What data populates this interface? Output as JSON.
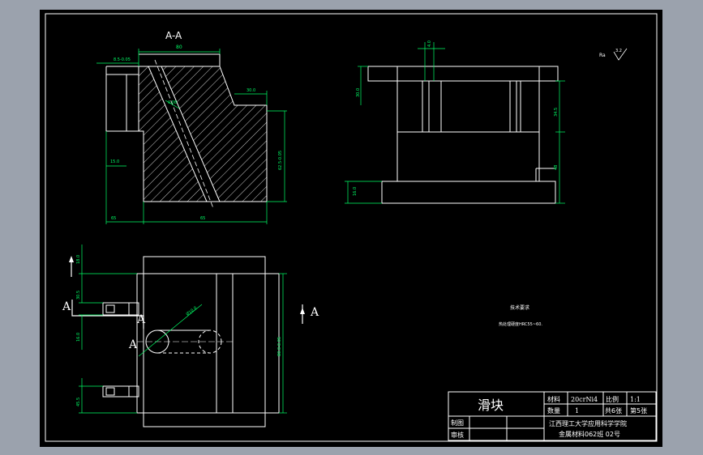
{
  "section_title": "A-A",
  "section_marks": {
    "a_left_top": "A",
    "a_left_mid": "A",
    "a_left_low": "A",
    "a_right": "A"
  },
  "dimensions": {
    "top_width": "80",
    "left_small": "8.5-0.05",
    "step_width": "30.0",
    "bottom_left": "65",
    "bottom_right": "65",
    "left_height": "15.0",
    "right_height": "62.5-0.05",
    "hole_angle": "0.08",
    "side_top": "4.0",
    "side_left_high": "30.0",
    "side_right_upper": "34.5",
    "side_right_lower": "48",
    "side_left_low": "16.0",
    "plan_left_1": "18.0",
    "plan_left_2": "30.5",
    "plan_left_3": "16.0",
    "plan_left_4": "45.5",
    "plan_diameter": "Ø10.0",
    "plan_right_height": "80.0-0.05"
  },
  "roughness": {
    "label": "Ra",
    "value": "3.2"
  },
  "tech_requirements": {
    "title": "技术要求",
    "line1": "热处理硬度HRC55~60."
  },
  "title_block": {
    "part_name": "滑块",
    "material_label": "材料",
    "material_value": "20crNi4",
    "scale_label": "比例",
    "scale_value": "1:1",
    "qty_label": "数量",
    "qty_value": "1",
    "sheets_total": "共6张",
    "sheet_no": "第5张",
    "drawn_label": "制图",
    "checked_label": "审核",
    "school": "江西理工大学应用科学学院",
    "class": "金属材料062班   02号"
  }
}
